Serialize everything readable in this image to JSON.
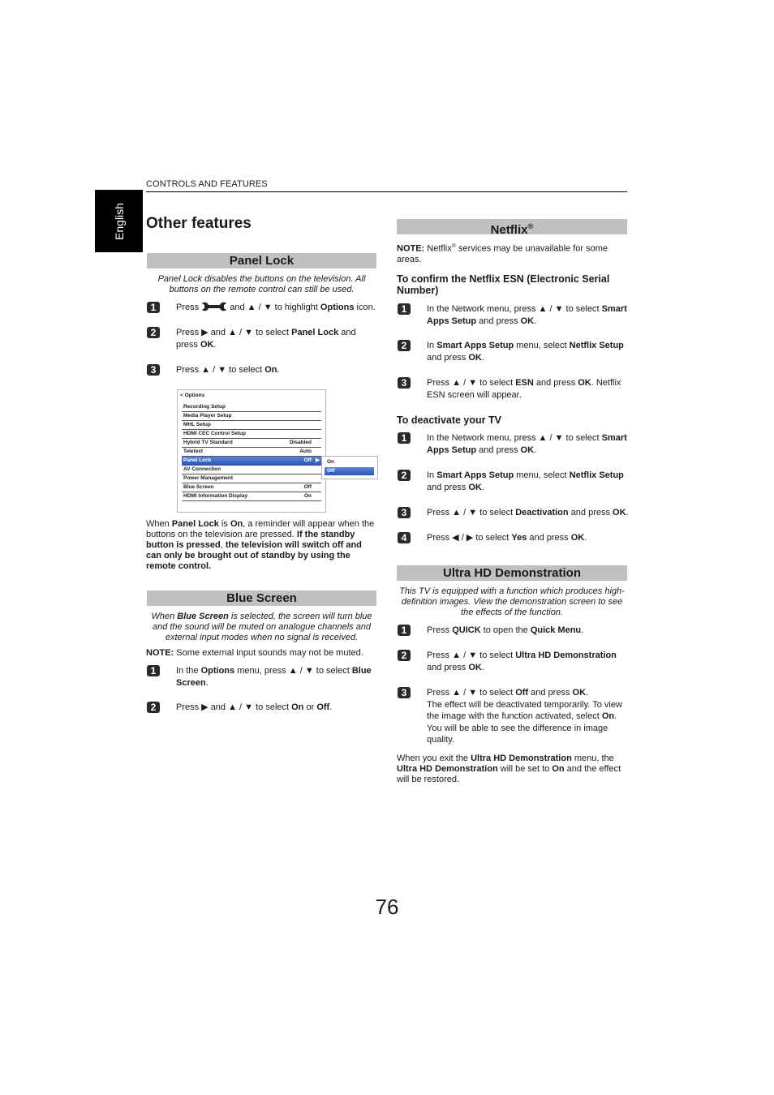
{
  "header": {
    "running_head": "CONTROLS AND FEATURES",
    "language_tab": "English"
  },
  "page_title": "Other features",
  "page_number": "76",
  "panel_lock": {
    "heading": "Panel Lock",
    "intro": "Panel Lock disables the buttons on the television. All buttons on the remote control can still be used.",
    "steps": [
      {
        "num": "1",
        "html": "Press <span class='wrench'>&#x2012;</span> and &#9650; / &#9660; to highlight <b>Options</b> icon."
      },
      {
        "num": "2",
        "html": "Press &#9654; and &#9650; / &#9660; to select <b>Panel Lock</b> and<br>press <b>OK</b>."
      },
      {
        "num": "3",
        "html": "Press &#9650; / &#9660; to select <b>On</b>."
      }
    ],
    "step_icon_wrench": "wrench-icon",
    "menu": {
      "title": "< Options",
      "rows": [
        {
          "label": "Recording Setup",
          "value": ""
        },
        {
          "label": "Media Player Setup",
          "value": ""
        },
        {
          "label": "MHL Setup",
          "value": ""
        },
        {
          "label": "HDMI CEC Control Setup",
          "value": ""
        },
        {
          "label": "Hybrid TV Standard",
          "value": "Disabled"
        },
        {
          "label": "Teletext",
          "value": "Auto"
        },
        {
          "label": "Panel Lock",
          "value": "Off",
          "selected": true
        },
        {
          "label": "AV Connection",
          "value": ""
        },
        {
          "label": "Power Management",
          "value": ""
        },
        {
          "label": "Blue Screen",
          "value": "Off"
        },
        {
          "label": "HDMI Information Display",
          "value": "On"
        }
      ],
      "submenu_options": [
        {
          "label": "On"
        },
        {
          "label": "Off",
          "selected": true
        }
      ]
    },
    "after_html": "When <b>Panel Lock</b> is <b>On</b>, a reminder will appear when the buttons on the television are pressed. <b>If the standby button is pressed</b>, <b>the television will switch off and can only be brought out of standby by using the remote control.</b>"
  },
  "blue_screen": {
    "heading": "Blue Screen",
    "intro_html": "When <b>Blue Screen</b> is selected, the screen will turn blue and the sound will be muted on analogue channels and external input modes when no signal is received.",
    "note_label": "NOTE:",
    "note_text": " Some external input sounds may not be muted.",
    "steps": [
      {
        "num": "1",
        "html": "In the <b>Options</b> menu, press &#9650; / &#9660; to select <b>Blue<br>Screen</b>."
      },
      {
        "num": "2",
        "html": "Press &#9654; and &#9650; / &#9660; to select <b>On</b> or <b>Off</b>."
      }
    ]
  },
  "netflix": {
    "heading": "Netflix",
    "heading_sup": "®",
    "note_html": "<b>NOTE:</b> Netflix<sup>®</sup> services may be unavailable for some areas.",
    "esn_heading": "To confirm the Netflix ESN (Electronic Serial Number)",
    "esn_steps": [
      {
        "num": "1",
        "html": "In the Network menu, press &#9650; / &#9660; to select <b>Smart<br>Apps Setup</b> and press <b>OK</b>."
      },
      {
        "num": "2",
        "html": "In <b>Smart Apps Setup</b> menu, select <b>Netflix Setup</b><br>and press <b>OK</b>."
      },
      {
        "num": "3",
        "html": "Press &#9650; / &#9660; to select <b>ESN</b> and press <b>OK</b>. Netflix<br>ESN screen will appear."
      }
    ],
    "deactivate_heading": "To deactivate your TV",
    "deactivate_steps": [
      {
        "num": "1",
        "html": "In the Network menu, press &#9650; / &#9660; to select <b>Smart<br>Apps Setup</b> and press <b>OK</b>."
      },
      {
        "num": "2",
        "html": "In <b>Smart Apps Setup</b> menu, select <b>Netflix Setup</b><br>and press <b>OK</b>."
      },
      {
        "num": "3",
        "html": "Press &#9650; / &#9660; to select <b>Deactivation</b> and press <b>OK</b>."
      },
      {
        "num": "4",
        "html": "Press &#9664; / &#9654; to select <b>Yes</b> and press <b>OK</b>."
      }
    ]
  },
  "ultra_hd": {
    "heading": "Ultra HD Demonstration",
    "intro": "This TV is equipped with a function which produces high-definition images. View the demonstration screen to see the effects of the function.",
    "steps": [
      {
        "num": "1",
        "html": "Press <b>QUICK</b> to open the <b>Quick Menu</b>."
      },
      {
        "num": "2",
        "html": "Press &#9650; / &#9660; to select <b>Ultra HD Demonstration</b><br>and press <b>OK</b>."
      },
      {
        "num": "3",
        "html": "Press &#9650; / &#9660; to select <b>Off</b> and press <b>OK</b>.<br>The effect will be deactivated temporarily. To view<br>the image with the function activated, select <b>On</b>.<br>You will be able to see the difference in image<br>quality."
      }
    ],
    "after_html": "When you exit the <b>Ultra HD Demonstration</b> menu, the <b>Ultra HD Demonstration</b> will be set to <b>On</b> and the effect will be restored."
  }
}
